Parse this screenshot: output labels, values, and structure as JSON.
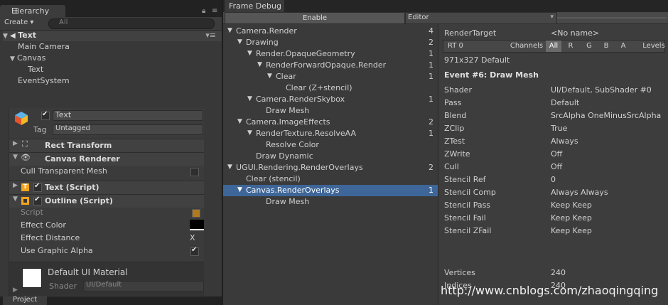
{
  "hierarchy": {
    "tab_label": "Hierarchy",
    "tab_icon": "list-icon",
    "create_label": "Create ▾",
    "search_placeholder": "All",
    "scene_name": "Text",
    "items": [
      {
        "label": "Main Camera"
      },
      {
        "label": "Canvas"
      },
      {
        "label": "Text"
      },
      {
        "label": "EventSystem"
      }
    ]
  },
  "inspector": {
    "object_name": "Text",
    "tag_label": "Tag",
    "tag_value": "Untagged",
    "rect_transform": "Rect Transform",
    "canvas_renderer": "Canvas Renderer",
    "cull_label": "Cull Transparent Mesh",
    "text_script": "Text (Script)",
    "outline_script": "Outline (Script)",
    "script_label": "Script",
    "effect_color_label": "Effect Color",
    "effect_distance_label": "Effect Distance",
    "effect_distance_x": "X",
    "graphic_alpha_label": "Use Graphic Alpha",
    "material_name": "Default UI Material",
    "shader_label": "Shader",
    "shader_value": "UI/Default",
    "project_tab": "Project"
  },
  "frame_debug": {
    "tab_label": "Frame Debug",
    "enable_label": "Enable",
    "editor_label": "Editor",
    "events": [
      {
        "name": "Camera.Render",
        "count": "4",
        "depth": 0,
        "arrow": "▼"
      },
      {
        "name": "Drawing",
        "count": "2",
        "depth": 1,
        "arrow": "▼"
      },
      {
        "name": "Render.OpaqueGeometry",
        "count": "1",
        "depth": 2,
        "arrow": "▼"
      },
      {
        "name": "RenderForwardOpaque.Render",
        "count": "1",
        "depth": 3,
        "arrow": "▼"
      },
      {
        "name": "Clear",
        "count": "1",
        "depth": 4,
        "arrow": "▼"
      },
      {
        "name": "Clear (Z+stencil)",
        "count": "",
        "depth": 5,
        "arrow": ""
      },
      {
        "name": "Camera.RenderSkybox",
        "count": "1",
        "depth": 2,
        "arrow": "▼"
      },
      {
        "name": "Draw Mesh",
        "count": "",
        "depth": 3,
        "arrow": ""
      },
      {
        "name": "Camera.ImageEffects",
        "count": "2",
        "depth": 1,
        "arrow": "▼"
      },
      {
        "name": "RenderTexture.ResolveAA",
        "count": "1",
        "depth": 2,
        "arrow": "▼"
      },
      {
        "name": "Resolve Color",
        "count": "",
        "depth": 3,
        "arrow": ""
      },
      {
        "name": "Draw Dynamic",
        "count": "",
        "depth": 2,
        "arrow": ""
      },
      {
        "name": "UGUI.Rendering.RenderOverlays",
        "count": "2",
        "depth": 0,
        "arrow": "▼"
      },
      {
        "name": "Clear (stencil)",
        "count": "",
        "depth": 1,
        "arrow": ""
      },
      {
        "name": "Canvas.RenderOverlays",
        "count": "1",
        "depth": 1,
        "arrow": "▼",
        "selected": true
      },
      {
        "name": "Draw Mesh",
        "count": "",
        "depth": 3,
        "arrow": ""
      }
    ],
    "render_target_label": "RenderTarget",
    "render_target_value": "<No name>",
    "rt_select": "RT 0",
    "channels_label": "Channels",
    "channel_buttons": [
      "All",
      "R",
      "G",
      "B",
      "A"
    ],
    "levels_label": "Levels",
    "resolution": "971x327 Default",
    "event_title": "Event #6: Draw Mesh",
    "properties": [
      {
        "label": "Shader",
        "value": "UI/Default, SubShader #0"
      },
      {
        "label": "Pass",
        "value": "Default"
      },
      {
        "label": "Blend",
        "value": "SrcAlpha OneMinusSrcAlpha"
      },
      {
        "label": "ZClip",
        "value": "True"
      },
      {
        "label": "ZTest",
        "value": "Always"
      },
      {
        "label": "ZWrite",
        "value": "Off"
      },
      {
        "label": "Cull",
        "value": "Off"
      },
      {
        "label": "Stencil Ref",
        "value": "0"
      },
      {
        "label": "Stencil Comp",
        "value": "Always Always"
      },
      {
        "label": "Stencil Pass",
        "value": "Keep Keep"
      },
      {
        "label": "Stencil Fail",
        "value": "Keep Keep"
      },
      {
        "label": "Stencil ZFail",
        "value": "Keep Keep"
      }
    ],
    "vertices_label": "Vertices",
    "vertices_value": "240",
    "indices_label": "Indices",
    "indices_value": "240"
  },
  "watermark": "http://www.cnblogs.com/zhaoqingqing",
  "colors": {
    "selection": "#3e6698",
    "panel": "#3d3d3d",
    "tab_bar": "#222222"
  }
}
